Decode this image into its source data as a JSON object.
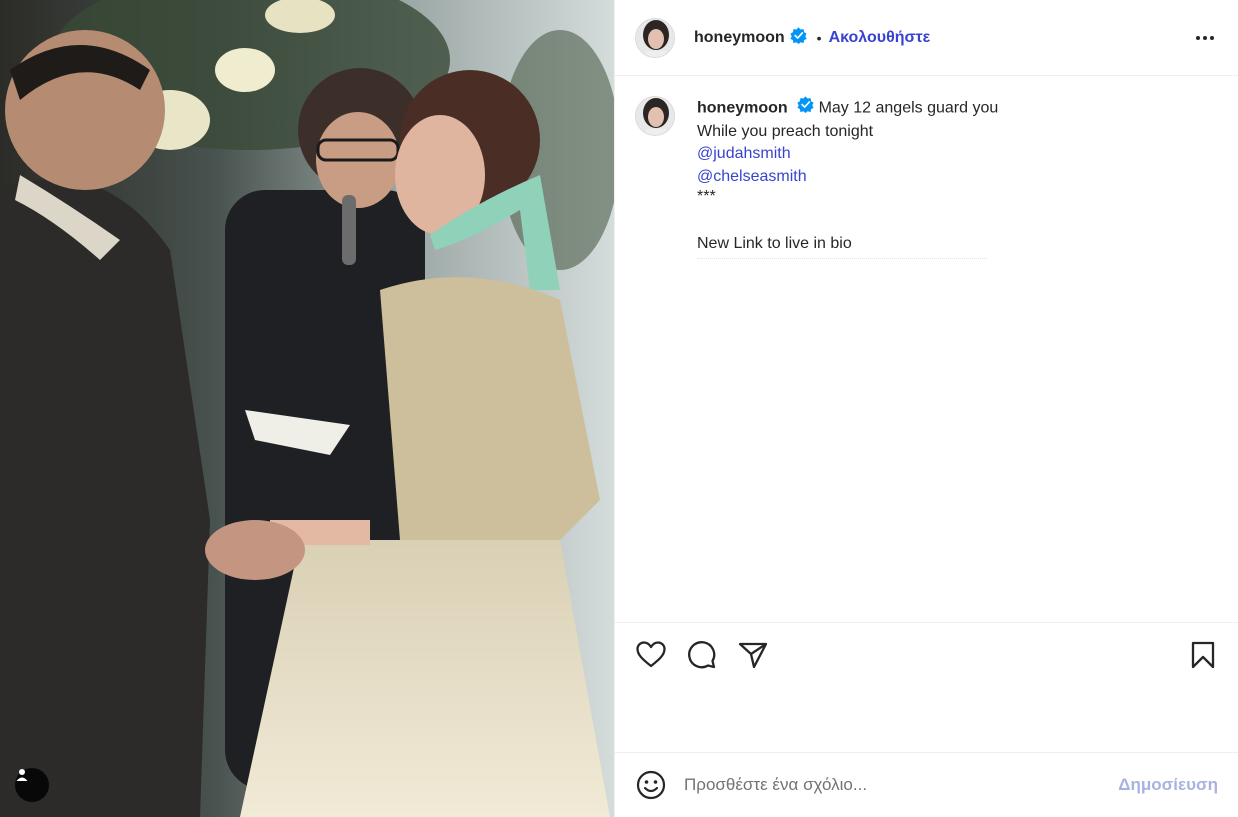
{
  "media": {
    "tag_icon": "person-icon"
  },
  "header": {
    "username": "honeymoon",
    "verified_icon": "verified-badge-icon",
    "separator": "•",
    "follow_label": "Ακολουθήστε",
    "more_icon": "more-options-icon"
  },
  "caption": {
    "username": "honeymoon",
    "lines": [
      "May 12 angels guard you",
      "While you preach tonight",
      "@judahsmith",
      "@chelseasmith",
      "***",
      "",
      "New Link to live in bio"
    ]
  },
  "actions": {
    "like_icon": "heart-icon",
    "comment_icon": "comment-icon",
    "share_icon": "share-icon",
    "save_icon": "bookmark-icon"
  },
  "comment": {
    "emoji_icon": "emoji-icon",
    "placeholder": "Προσθέστε ένα σχόλιο...",
    "post_label": "Δημοσίευση"
  },
  "colors": {
    "accent": "#3843d0",
    "verified": "#0095f6",
    "post_disabled": "#a9b3e0"
  }
}
